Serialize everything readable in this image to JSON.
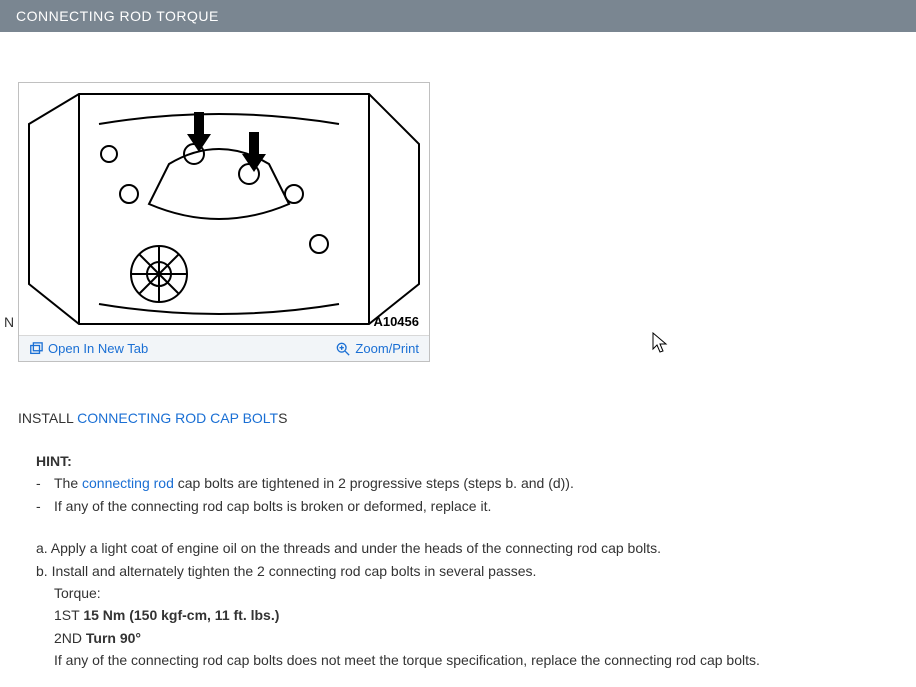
{
  "header": {
    "title": "CONNECTING ROD TORQUE"
  },
  "diagram": {
    "ref_label": "A10456",
    "side_mark": "N"
  },
  "toolbar": {
    "open_tab_label": "Open In New Tab",
    "zoom_label": "Zoom/Print"
  },
  "section": {
    "prefix": "INSTALL ",
    "link": "CONNECTING ROD CAP BOLT",
    "suffix": "S"
  },
  "hint": {
    "label": "HINT:",
    "item1_pre": "The ",
    "item1_link": "connecting rod",
    "item1_post": " cap bolts are tightened in 2 progressive steps (steps b. and (d)).",
    "item2": "If any of the connecting rod cap bolts is broken or deformed, replace it."
  },
  "steps": {
    "a": "a. Apply a light coat of engine oil on the threads and under the heads of the connecting rod cap bolts.",
    "b": "b. Install and alternately tighten the 2 connecting rod cap bolts in several passes.",
    "torque_label": "Torque:",
    "t1_pre": "1ST ",
    "t1_bold": "15 Nm (150 kgf-cm, 11 ft. lbs.)",
    "t2_pre": "2ND ",
    "t2_bold": "Turn 90°",
    "note": "If any of the connecting rod cap bolts does not meet the torque specification, replace the connecting rod cap bolts."
  }
}
